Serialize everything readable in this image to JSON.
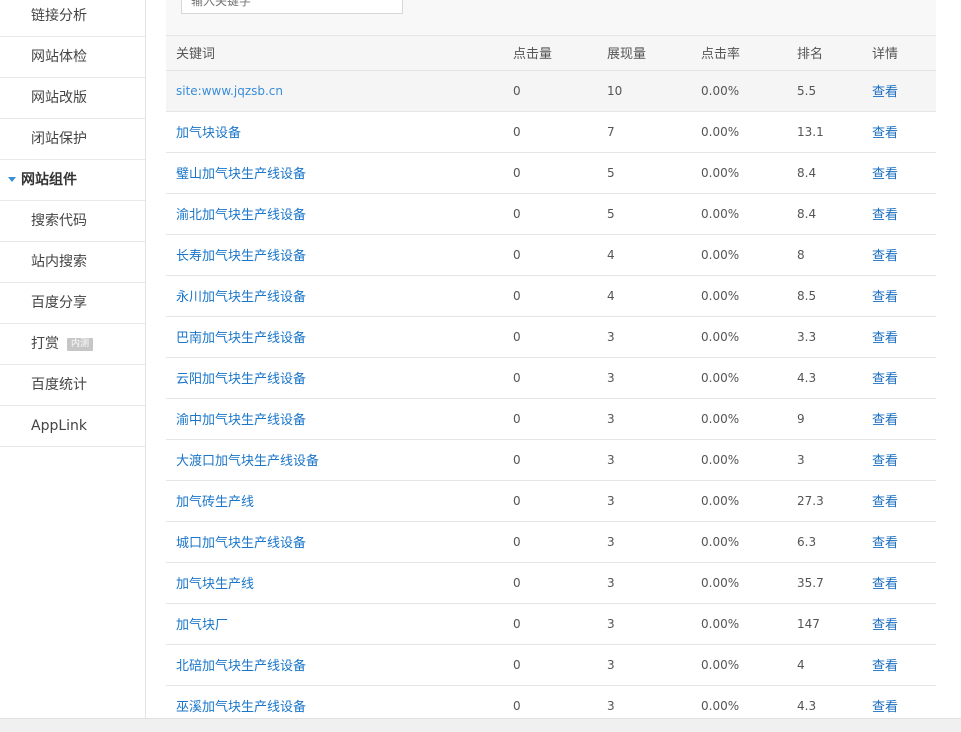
{
  "sidebar": {
    "items_top": [
      "链接分析",
      "网站体检",
      "网站改版",
      "闭站保护"
    ],
    "group_title": "网站组件",
    "items_group": [
      {
        "label": "搜索代码",
        "badge": ""
      },
      {
        "label": "站内搜索",
        "badge": ""
      },
      {
        "label": "百度分享",
        "badge": ""
      },
      {
        "label": "打赏",
        "badge": "内测"
      },
      {
        "label": "百度统计",
        "badge": ""
      },
      {
        "label": "AppLink",
        "badge": ""
      }
    ]
  },
  "search": {
    "placeholder": "输入关键字"
  },
  "table": {
    "headers": [
      "关键词",
      "点击量",
      "展现量",
      "点击率",
      "排名",
      "详情"
    ],
    "rows": [
      {
        "keyword": "site:www.jqzsb.cn",
        "clicks": "0",
        "impressions": "10",
        "ctr": "0.00%",
        "rank": "5.5",
        "action": "查看"
      },
      {
        "keyword": "加气块设备",
        "clicks": "0",
        "impressions": "7",
        "ctr": "0.00%",
        "rank": "13.1",
        "action": "查看"
      },
      {
        "keyword": "璧山加气块生产线设备",
        "clicks": "0",
        "impressions": "5",
        "ctr": "0.00%",
        "rank": "8.4",
        "action": "查看"
      },
      {
        "keyword": "渝北加气块生产线设备",
        "clicks": "0",
        "impressions": "5",
        "ctr": "0.00%",
        "rank": "8.4",
        "action": "查看"
      },
      {
        "keyword": "长寿加气块生产线设备",
        "clicks": "0",
        "impressions": "4",
        "ctr": "0.00%",
        "rank": "8",
        "action": "查看"
      },
      {
        "keyword": "永川加气块生产线设备",
        "clicks": "0",
        "impressions": "4",
        "ctr": "0.00%",
        "rank": "8.5",
        "action": "查看"
      },
      {
        "keyword": "巴南加气块生产线设备",
        "clicks": "0",
        "impressions": "3",
        "ctr": "0.00%",
        "rank": "3.3",
        "action": "查看"
      },
      {
        "keyword": "云阳加气块生产线设备",
        "clicks": "0",
        "impressions": "3",
        "ctr": "0.00%",
        "rank": "4.3",
        "action": "查看"
      },
      {
        "keyword": "渝中加气块生产线设备",
        "clicks": "0",
        "impressions": "3",
        "ctr": "0.00%",
        "rank": "9",
        "action": "查看"
      },
      {
        "keyword": "大渡口加气块生产线设备",
        "clicks": "0",
        "impressions": "3",
        "ctr": "0.00%",
        "rank": "3",
        "action": "查看"
      },
      {
        "keyword": "加气砖生产线",
        "clicks": "0",
        "impressions": "3",
        "ctr": "0.00%",
        "rank": "27.3",
        "action": "查看"
      },
      {
        "keyword": "城口加气块生产线设备",
        "clicks": "0",
        "impressions": "3",
        "ctr": "0.00%",
        "rank": "6.3",
        "action": "查看"
      },
      {
        "keyword": "加气块生产线",
        "clicks": "0",
        "impressions": "3",
        "ctr": "0.00%",
        "rank": "35.7",
        "action": "查看"
      },
      {
        "keyword": "加气块厂",
        "clicks": "0",
        "impressions": "3",
        "ctr": "0.00%",
        "rank": "147",
        "action": "查看"
      },
      {
        "keyword": "北碚加气块生产线设备",
        "clicks": "0",
        "impressions": "3",
        "ctr": "0.00%",
        "rank": "4",
        "action": "查看"
      },
      {
        "keyword": "巫溪加气块生产线设备",
        "clicks": "0",
        "impressions": "3",
        "ctr": "0.00%",
        "rank": "4.3",
        "action": "查看"
      }
    ]
  },
  "colors": {
    "link": "#1a76c9",
    "accent": "#3a8fd4"
  }
}
